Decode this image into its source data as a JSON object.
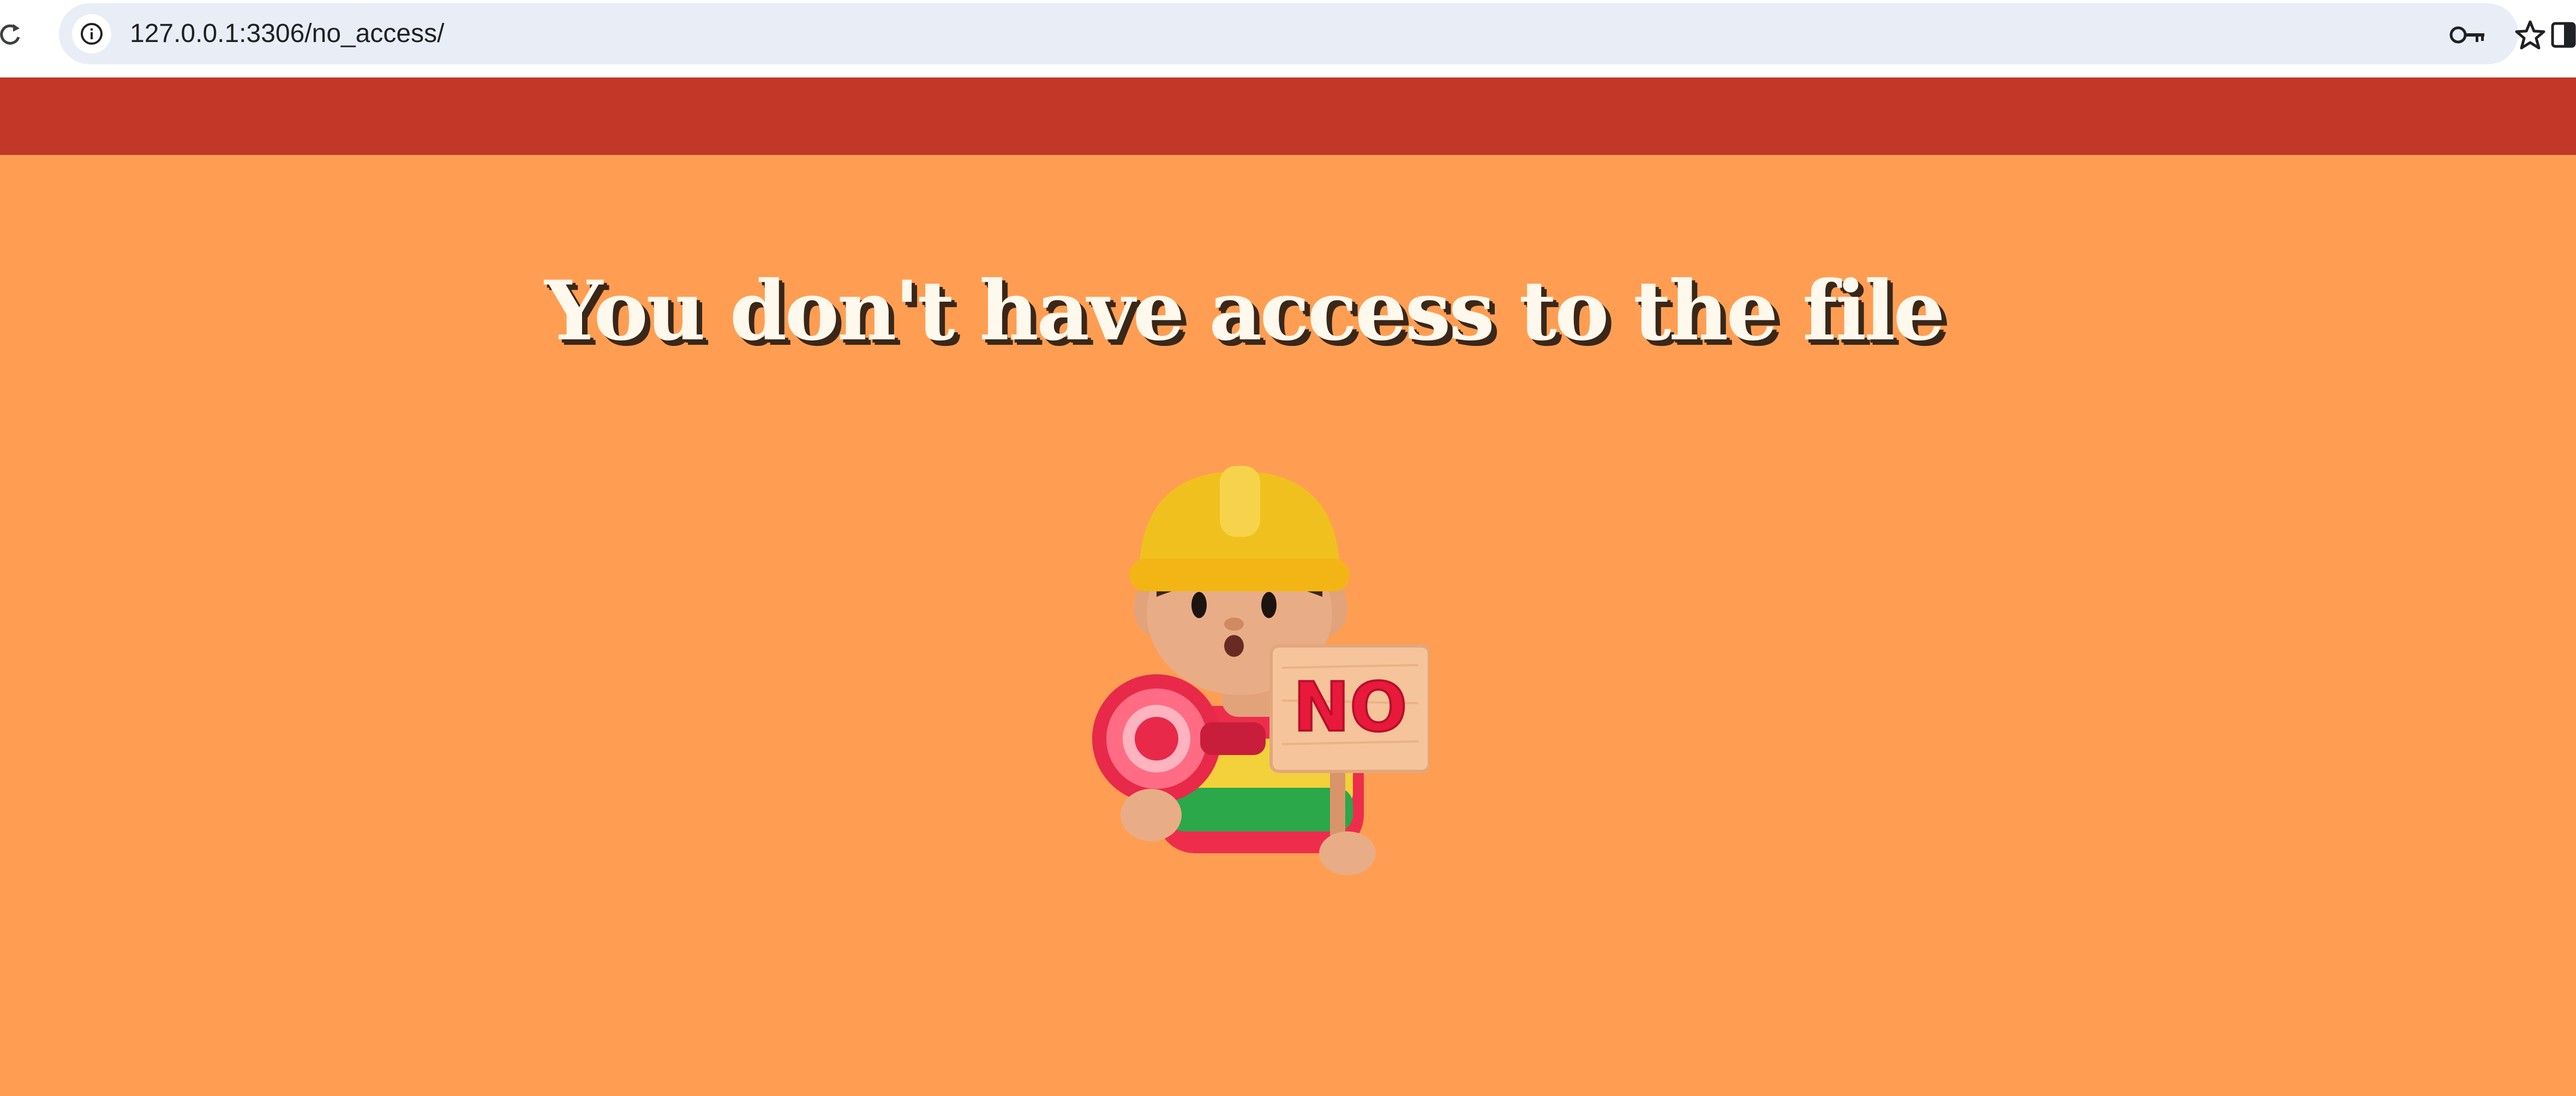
{
  "browser": {
    "url": "127.0.0.1:3306/no_access/",
    "icons": [
      "reload-icon",
      "info-icon",
      "password-key-icon",
      "bookmark-star-icon",
      "side-panel-icon"
    ]
  },
  "page": {
    "title": "You don't have access to the file",
    "illustration": {
      "name": "construction-worker-no-sign",
      "sign_text": "NO"
    },
    "colors": {
      "banner": "#c23728",
      "background": "#ff9e52",
      "title": "#fff8ec",
      "title_shadow": "#3a2718"
    }
  }
}
